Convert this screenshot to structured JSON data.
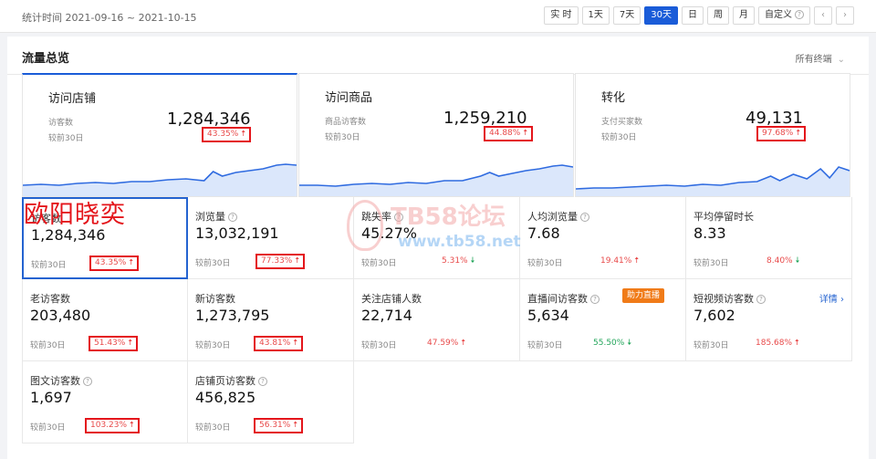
{
  "topbar": {
    "stat_time": "统计时间 2021-09-16 ~ 2021-10-15",
    "range_buttons": [
      "实 时",
      "1天",
      "7天",
      "30天",
      "日",
      "周",
      "月",
      "自定义"
    ],
    "active_range": "30天",
    "prev_icon": "chevron-left-icon",
    "next_icon": "chevron-right-icon"
  },
  "panel": {
    "title": "流量总览",
    "terminal_select": "所有终端"
  },
  "big_cards": [
    {
      "title": "访问店铺",
      "sub": "访客数",
      "value": "1,284,346",
      "compare": "较前30日",
      "change": "43.35%",
      "trend": "up"
    },
    {
      "title": "访问商品",
      "sub": "商品访客数",
      "value": "1,259,210",
      "compare": "较前30日",
      "change": "44.88%",
      "trend": "up"
    },
    {
      "title": "转化",
      "sub": "支付买家数",
      "value": "49,131",
      "compare": "较前30日",
      "change": "97.68%",
      "trend": "up"
    }
  ],
  "cells": [
    {
      "label": "访客数",
      "value": "1,284,346",
      "compare": "较前30日",
      "change": "43.35%",
      "trend": "up"
    },
    {
      "label": "浏览量",
      "value": "13,032,191",
      "compare": "较前30日",
      "change": "77.33%",
      "trend": "up"
    },
    {
      "label": "跳失率",
      "value": "45.27%",
      "compare": "较前30日",
      "change": "5.31%",
      "trend": "down"
    },
    {
      "label": "人均浏览量",
      "value": "7.68",
      "compare": "较前30日",
      "change": "19.41%",
      "trend": "up"
    },
    {
      "label": "平均停留时长",
      "value": "8.33",
      "compare": "较前30日",
      "change": "8.40%",
      "trend": "down"
    },
    {
      "label": "老访客数",
      "value": "203,480",
      "compare": "较前30日",
      "change": "51.43%",
      "trend": "up"
    },
    {
      "label": "新访客数",
      "value": "1,273,795",
      "compare": "较前30日",
      "change": "43.81%",
      "trend": "up"
    },
    {
      "label": "关注店铺人数",
      "value": "22,714",
      "compare": "较前30日",
      "change": "47.59%",
      "trend": "up"
    },
    {
      "label": "直播间访客数",
      "value": "5,634",
      "compare": "较前30日",
      "change": "55.50%",
      "trend": "down",
      "tag": "助力直播"
    },
    {
      "label": "短视频访客数",
      "value": "7,602",
      "compare": "较前30日",
      "change": "185.68%",
      "trend": "up",
      "link": "详情"
    },
    {
      "label": "图文访客数",
      "value": "1,697",
      "compare": "较前30日",
      "change": "103.23%",
      "trend": "up"
    },
    {
      "label": "店铺页访客数",
      "value": "456,825",
      "compare": "较前30日",
      "change": "56.31%",
      "trend": "up"
    }
  ],
  "overlay": {
    "name_text": "欧阳晓奕",
    "watermark_title": "TB58论坛",
    "watermark_url": "www.tb58.net"
  },
  "colors": {
    "accent": "#1a5cd8",
    "up": "#e84a4a",
    "down": "#22a55a",
    "highlight_box": "#e4151b",
    "live_tag": "#f07b18"
  }
}
